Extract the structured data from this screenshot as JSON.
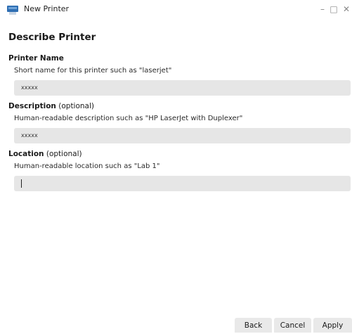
{
  "window": {
    "title": "New Printer",
    "minimize_glyph": "–",
    "maximize_glyph": "□",
    "close_glyph": "✕",
    "icon": "printer-icon"
  },
  "page": {
    "heading": "Describe Printer"
  },
  "printer_name": {
    "label": "Printer Name",
    "hint": "Short name for this printer such as \"laserjet\"",
    "value": "xxxxx"
  },
  "description": {
    "label": "Description",
    "optional": " (optional)",
    "hint": "Human-readable description such as \"HP LaserJet with Duplexer\"",
    "value": "xxxxx"
  },
  "location": {
    "label": "Location",
    "optional": " (optional)",
    "hint": "Human-readable location such as \"Lab 1\"",
    "value": ""
  },
  "buttons": {
    "back": "Back",
    "cancel": "Cancel",
    "apply": "Apply"
  },
  "colors": {
    "field_bg": "#e6e6e6",
    "icon_blue": "#2f6fb3"
  }
}
